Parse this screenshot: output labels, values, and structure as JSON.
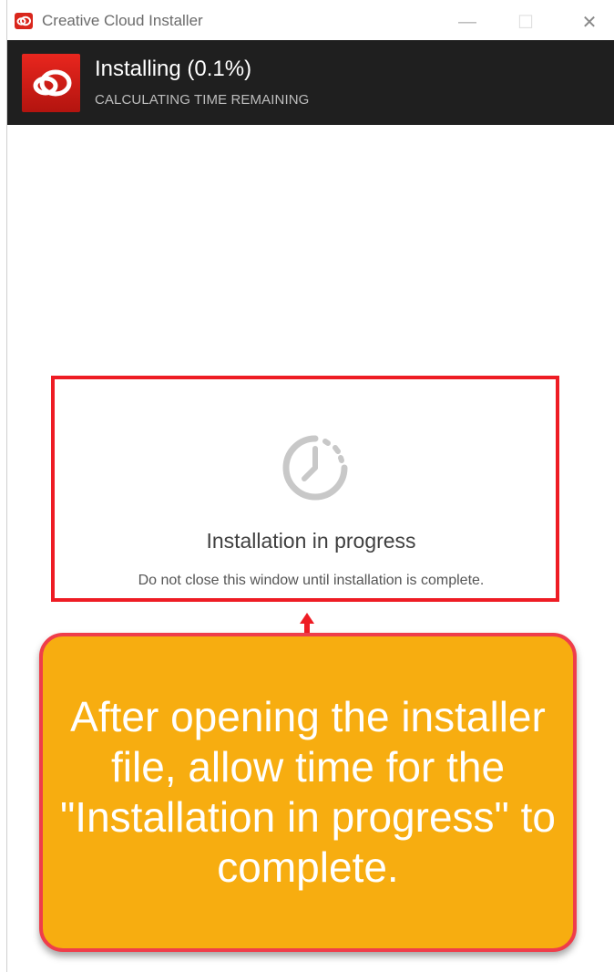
{
  "window": {
    "title": "Creative Cloud Installer",
    "minimize_glyph": "—",
    "maximize_glyph": "☐",
    "close_glyph": "✕"
  },
  "header": {
    "status_title": "Installing (0.1%)",
    "status_subtitle": "CALCULATING TIME REMAINING",
    "progress_percent": 0.1,
    "logo_icon": "creative-cloud-logo-icon"
  },
  "main": {
    "spinner_icon": "clock-spinner-icon",
    "progress_title": "Installation in progress",
    "progress_message": "Do not close this window until installation is complete."
  },
  "annotation": {
    "callout_text": "After opening the installer file, allow time for the \"Installation in progress\" to complete.",
    "highlight_color": "#ee1c24",
    "callout_color": "#f7ad10",
    "callout_border_color": "#ef3d4a"
  },
  "colors": {
    "header_bg": "#1f1f1f",
    "brand_red": "#e8261e"
  }
}
